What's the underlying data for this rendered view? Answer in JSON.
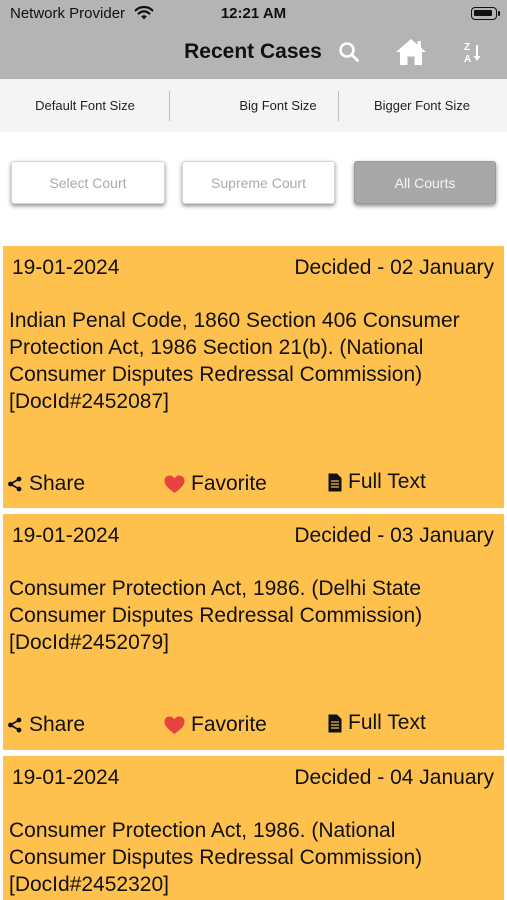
{
  "status_bar": {
    "provider": "Network Provider",
    "time": "12:21 AM"
  },
  "nav": {
    "title": "Recent Cases",
    "icons": [
      "search-icon",
      "home-icon",
      "sort-icon"
    ],
    "sort_glyph_top": "Z",
    "sort_glyph_bottom": "A"
  },
  "font_sizes": [
    {
      "label": "Default Font Size"
    },
    {
      "label": "Big Font Size"
    },
    {
      "label": "Bigger Font Size"
    }
  ],
  "courts": [
    {
      "label": "Select Court",
      "active": false
    },
    {
      "label": "Supreme Court",
      "active": false
    },
    {
      "label": "All Courts",
      "active": true
    }
  ],
  "cases": [
    {
      "date": "19-01-2024",
      "status": "Decided - 02 January",
      "description": "Indian Penal Code, 1860 Section 406 Consumer Protection Act, 1986 Section 21(b). (National Consumer Disputes Redressal Commission) [DocId#2452087]",
      "share_label": "Share",
      "favorite_label": "Favorite",
      "fulltext_label": "Full Text"
    },
    {
      "date": "19-01-2024",
      "status": "Decided - 03 January",
      "description": "Consumer Protection Act, 1986. (Delhi State Consumer Disputes Redressal Commission) [DocId#2452079]",
      "share_label": "Share",
      "favorite_label": "Favorite",
      "fulltext_label": "Full Text"
    },
    {
      "date": "19-01-2024",
      "status": "Decided - 04 January",
      "description": "Consumer Protection Act, 1986. (National Consumer Disputes Redressal Commission) [DocId#2452320]"
    }
  ],
  "colors": {
    "header_bg": "#b4b4b4",
    "card_bg": "#ffc14d",
    "favorite_heart": "#e8423f",
    "active_court_bg": "#a8a8a8"
  }
}
